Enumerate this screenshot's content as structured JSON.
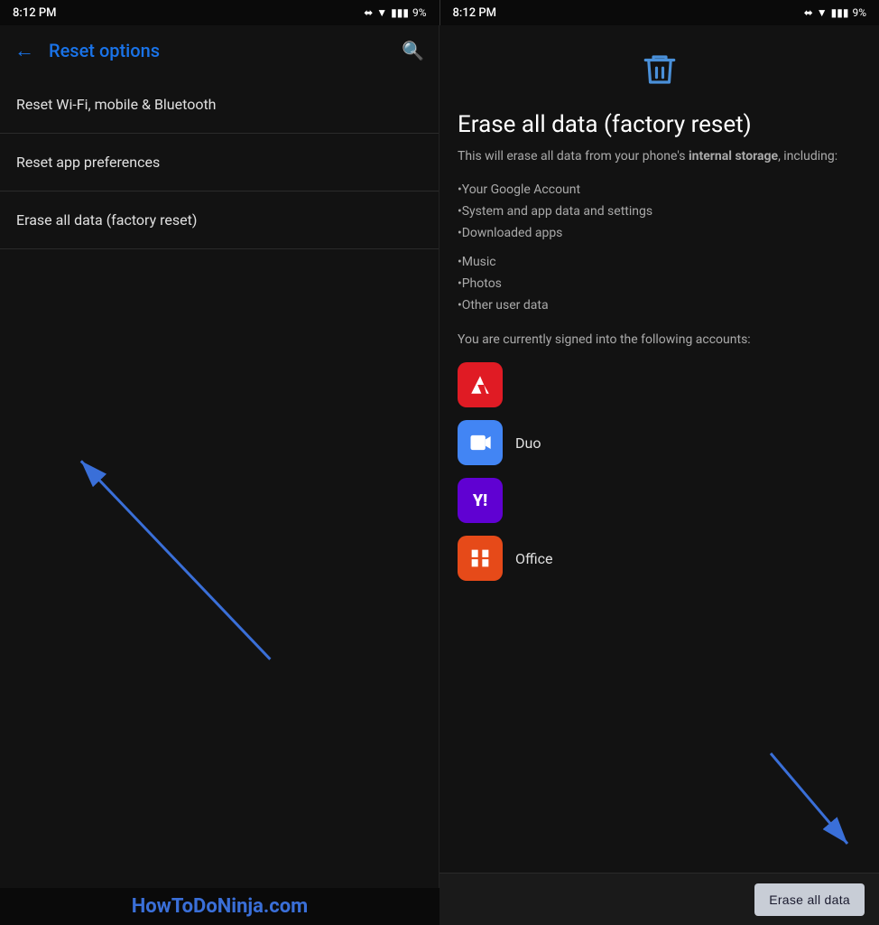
{
  "statusBar": {
    "left": {
      "time": "8:12 PM",
      "batteryPercent": "9%"
    },
    "right": {
      "time": "8:12 PM",
      "batteryPercent": "9%"
    }
  },
  "leftPanel": {
    "backIcon": "←",
    "title": "Reset options",
    "searchIcon": "⌕",
    "menuItems": [
      {
        "label": "Reset Wi-Fi, mobile & Bluetooth"
      },
      {
        "label": "Reset app preferences"
      },
      {
        "label": "Erase all data (factory reset)"
      }
    ]
  },
  "rightPanel": {
    "trashIcon": "🗑",
    "title": "Erase all data (factory reset)",
    "description1": "This will erase all data from your phone's ",
    "descriptionBold": "internal storage",
    "description2": ", including:",
    "dataItems": [
      "•Your Google Account",
      "•System and app data and settings",
      "•Downloaded apps",
      "•Music",
      "•Photos",
      "•Other user data"
    ],
    "signedInText": "You are currently signed into the following accounts:",
    "apps": [
      {
        "name": "adobe",
        "label": "",
        "icon": "A"
      },
      {
        "name": "duo",
        "label": "Duo",
        "icon": "▶"
      },
      {
        "name": "yahoo",
        "label": "",
        "icon": "Y!"
      },
      {
        "name": "office",
        "label": "Office",
        "icon": "⊞"
      }
    ],
    "eraseButton": "Erase all data"
  },
  "watermark": "HowToDoNinja.com"
}
